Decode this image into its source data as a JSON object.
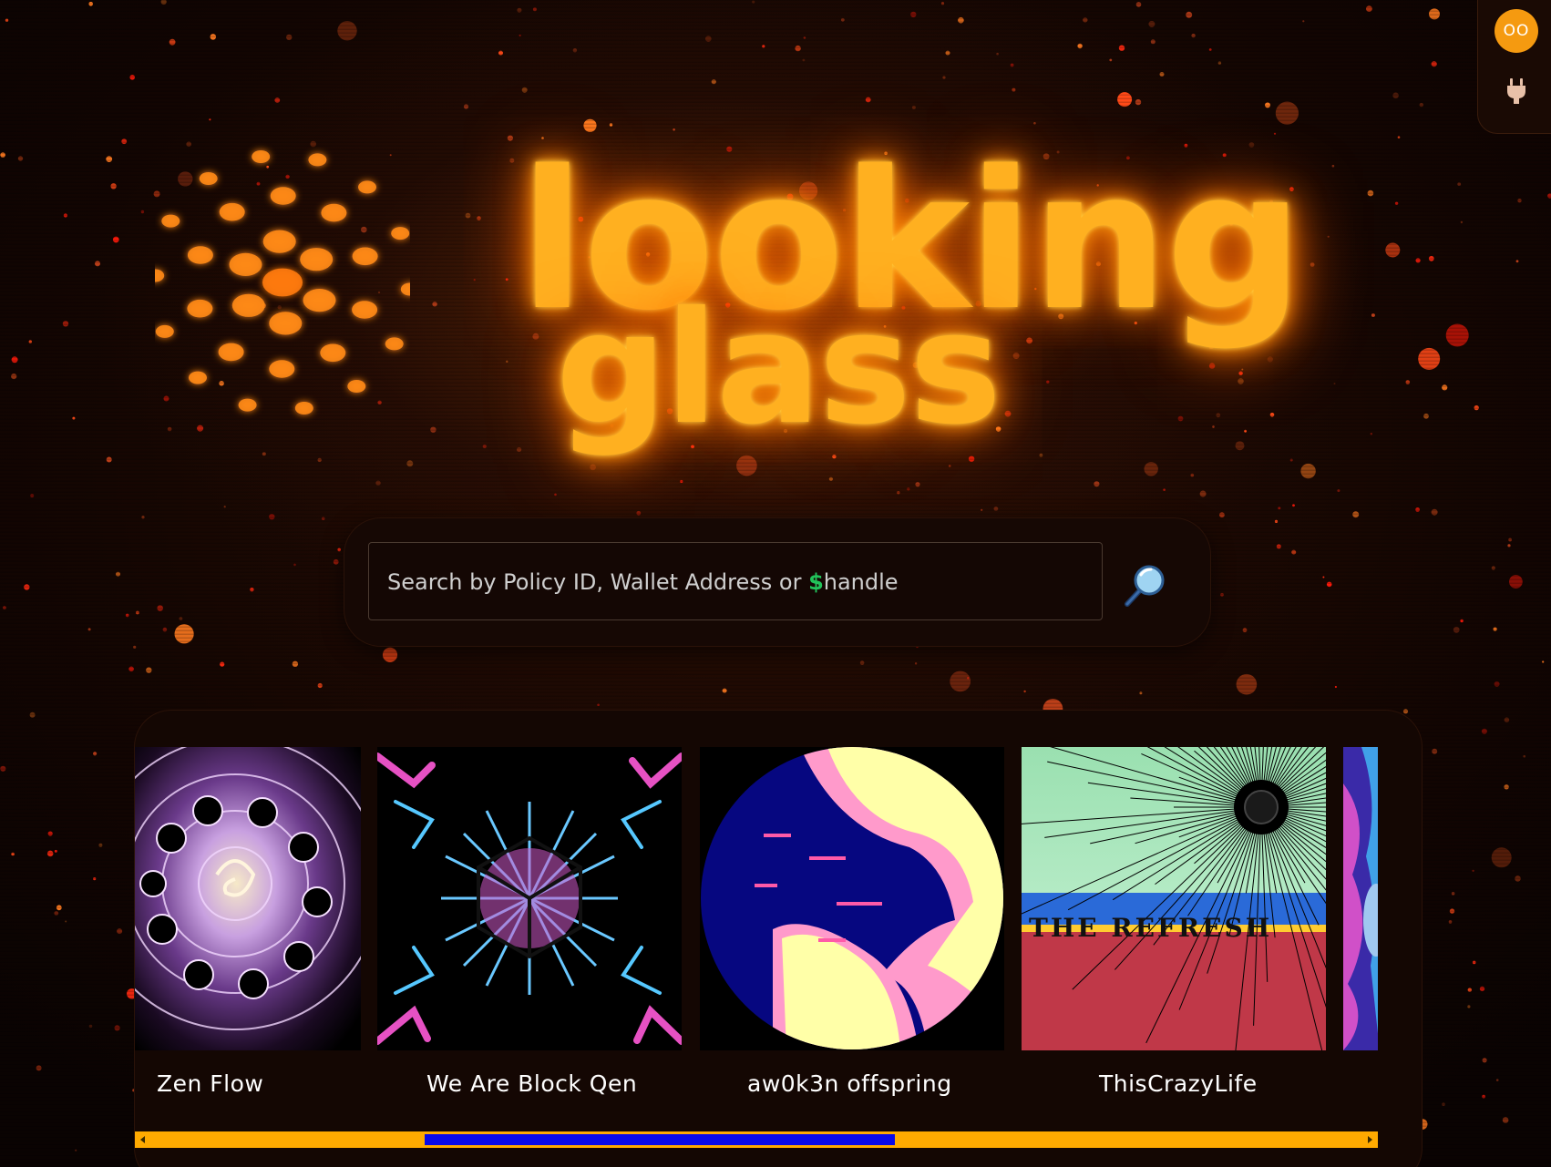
{
  "app": {
    "logo_line1": "looking",
    "logo_line2": "glass"
  },
  "account": {
    "avatar_initials": "OO",
    "connect_icon": "plug-icon"
  },
  "search": {
    "placeholder_prefix": "Search by Policy ID, Wallet Address or ",
    "placeholder_dollar": "$",
    "placeholder_suffix": "handle",
    "button_icon": "magnifier-icon"
  },
  "carousel": {
    "items": [
      {
        "name": "Zen Flow"
      },
      {
        "name": "We Are Block Qen"
      },
      {
        "name": "aw0k3n offspring"
      },
      {
        "name": "ThisCrazyLife",
        "art_text": "THE REFRESH"
      },
      {
        "name": ""
      }
    ],
    "scroll_position": 0.25,
    "scroll_visible_fraction": 0.38
  },
  "colors": {
    "accent_orange": "#f59a10",
    "glow": "#ffb020",
    "scroll_track": "#ffaa00",
    "scroll_thumb": "#0a0ae8",
    "dollar_green": "#22c25a"
  }
}
